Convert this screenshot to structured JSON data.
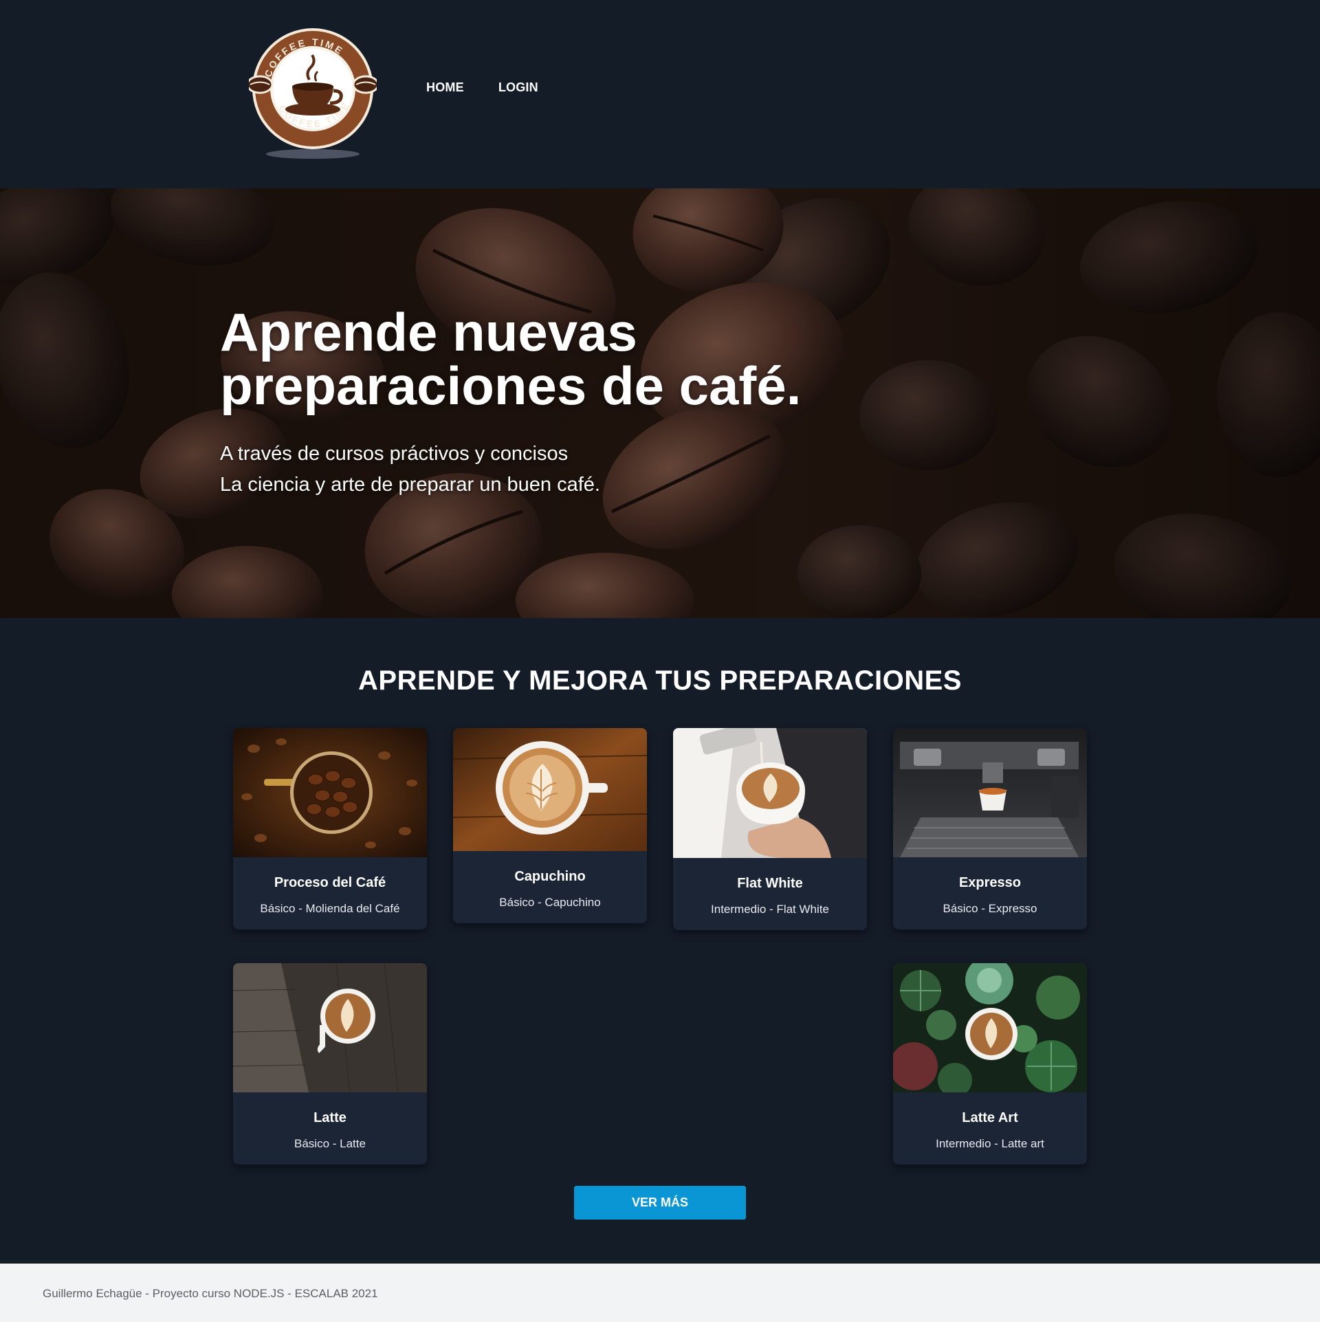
{
  "header": {
    "logo_text": "COFFEE TIME",
    "nav": [
      {
        "label": "HOME"
      },
      {
        "label": "LOGIN"
      }
    ]
  },
  "hero": {
    "title_line1": "Aprende nuevas",
    "title_line2": "preparaciones de café.",
    "subtitle_line1": "A través de cursos práctivos y concisos",
    "subtitle_line2": "La ciencia y arte de preparar un buen café."
  },
  "section": {
    "title": "APRENDE Y MEJORA TUS PREPARACIONES"
  },
  "cards": [
    {
      "title": "Proceso del Café",
      "subtitle": "Básico - Molienda del Café",
      "image": "coffee-beans-cup-photo"
    },
    {
      "title": "Capuchino",
      "subtitle": "Básico - Capuchino",
      "image": "capuchino-photo"
    },
    {
      "title": "Flat White",
      "subtitle": "Intermedio - Flat White",
      "image": "flat-white-photo"
    },
    {
      "title": "Expresso",
      "subtitle": "Básico - Expresso",
      "image": "espresso-machine-photo"
    },
    {
      "title": "Latte",
      "subtitle": "Básico - Latte",
      "image": "latte-photo"
    },
    {
      "title": "Latte Art",
      "subtitle": "Intermedio - Latte art",
      "image": "latte-art-succulents-photo"
    }
  ],
  "button": {
    "label": "VER MÁS"
  },
  "footer": {
    "text": "Guillermo Echagüe - Proyecto curso NODE.JS - ESCALAB 2021"
  },
  "colors": {
    "background": "#141c28",
    "card": "#1b2536",
    "button": "#0a95d4",
    "footer": "#f2f3f5"
  }
}
